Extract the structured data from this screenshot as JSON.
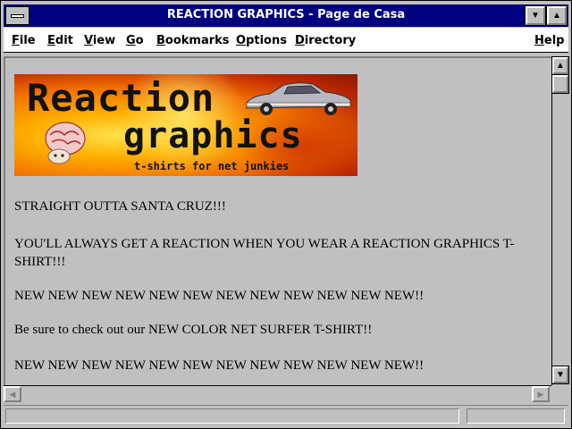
{
  "window": {
    "title": "REACTION GRAPHICS - Page de Casa"
  },
  "menu": {
    "items": [
      {
        "label": "File",
        "accel": "F",
        "rest": "ile"
      },
      {
        "label": "Edit",
        "accel": "E",
        "rest": "dit"
      },
      {
        "label": "View",
        "accel": "V",
        "rest": "iew"
      },
      {
        "label": "Go",
        "accel": "G",
        "rest": "o"
      },
      {
        "label": "Bookmarks",
        "accel": "B",
        "rest": "ookmarks"
      },
      {
        "label": "Options",
        "accel": "O",
        "rest": "ptions"
      },
      {
        "label": "Directory",
        "accel": "D",
        "rest": "irectory"
      },
      {
        "label": "Help",
        "accel": "H",
        "rest": "elp"
      }
    ]
  },
  "banner": {
    "word1": "Reaction",
    "word2": "graphics",
    "tagline": "t-shirts for net junkies"
  },
  "content": {
    "lines": [
      "STRAIGHT OUTTA SANTA CRUZ!!!",
      "YOU'LL ALWAYS GET A REACTION WHEN YOU WEAR A REACTION GRAPHICS T-SHIRT!!!",
      "NEW NEW NEW NEW NEW NEW NEW NEW NEW NEW NEW NEW!!",
      "Be sure to check out our NEW COLOR NET SURFER T-SHIRT!!",
      "NEW NEW NEW NEW NEW NEW NEW NEW NEW NEW NEW NEW!!"
    ]
  },
  "colors": {
    "titlebar": "#000080",
    "chrome": "#c0c0c0"
  },
  "icons": {
    "minimize": "triangle-down",
    "maximize": "triangle-up",
    "scroll_up": "arrow-up",
    "scroll_down": "arrow-down",
    "scroll_left": "arrow-left",
    "scroll_right": "arrow-right"
  }
}
